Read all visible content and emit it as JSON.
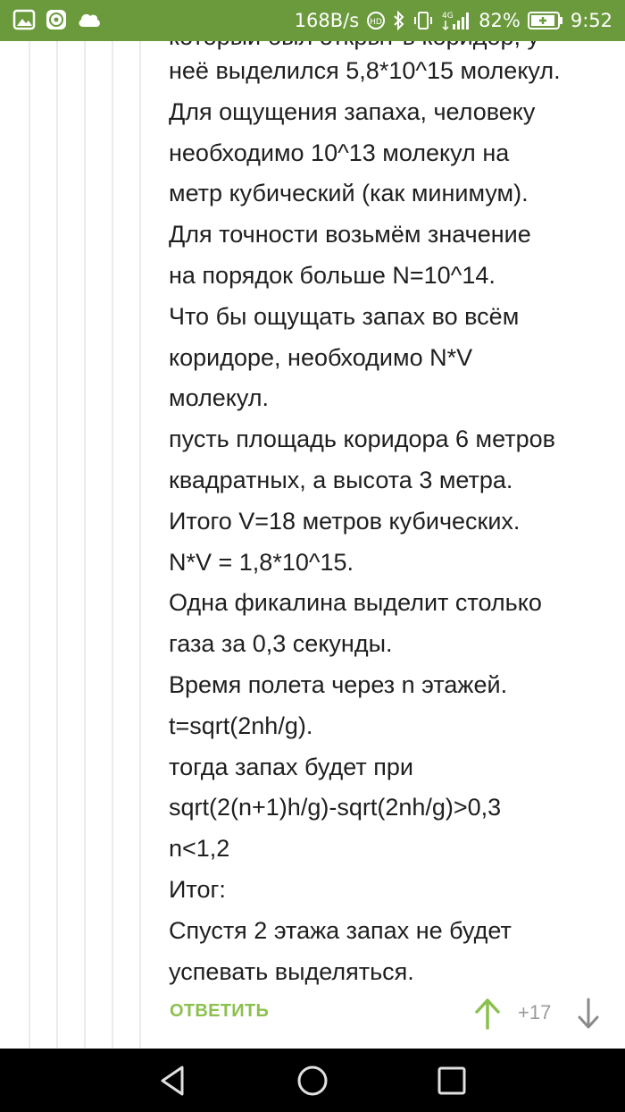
{
  "status_bar": {
    "network_speed": "168B/s",
    "network_type": "4G",
    "battery_percent": "82%",
    "time": "9:52",
    "icons": [
      "image-icon",
      "app-icon",
      "cloud-icon",
      "hd-icon",
      "bluetooth-icon",
      "vibrate-icon",
      "signal-icon",
      "battery-icon"
    ],
    "background_color": "#6b9a3d"
  },
  "comment": {
    "partial_top_line": "который был открыт в коридор, у",
    "lines": [
      "неё выделился 5,8*10^15 молекул.",
      "Для ощущения запаха, человеку",
      "необходимо 10^13 молекул на",
      "метр кубический (как минимум).",
      "Для точности возьмём значение",
      "на порядок больше N=10^14.",
      "Что бы ощущать запах во всём",
      "коридоре, необходимо N*V",
      "молекул.",
      "пусть площадь коридора 6 метров",
      "квадратных, а высота 3 метра.",
      "Итого V=18 метров кубических.",
      "N*V = 1,8*10^15.",
      "Одна фикалина выделит столько",
      "газа за 0,3 секунды.",
      "Время полета через n этажей.",
      "t=sqrt(2nh/g).",
      "тогда запах будет при",
      "sqrt(2(n+1)h/g)-sqrt(2nh/g)>0,3",
      "n<1,2",
      "Итог:",
      "Спустя 2 этажа запах не будет",
      "успевать выделяться."
    ]
  },
  "actions": {
    "reply_label": "ОТВЕТИТЬ",
    "score": "+17",
    "upvote_icon": "arrow-up-icon",
    "downvote_icon": "arrow-down-icon",
    "accent_color": "#8cc04e"
  },
  "nav_bar": {
    "buttons": [
      "back-icon",
      "home-icon",
      "recents-icon"
    ]
  }
}
